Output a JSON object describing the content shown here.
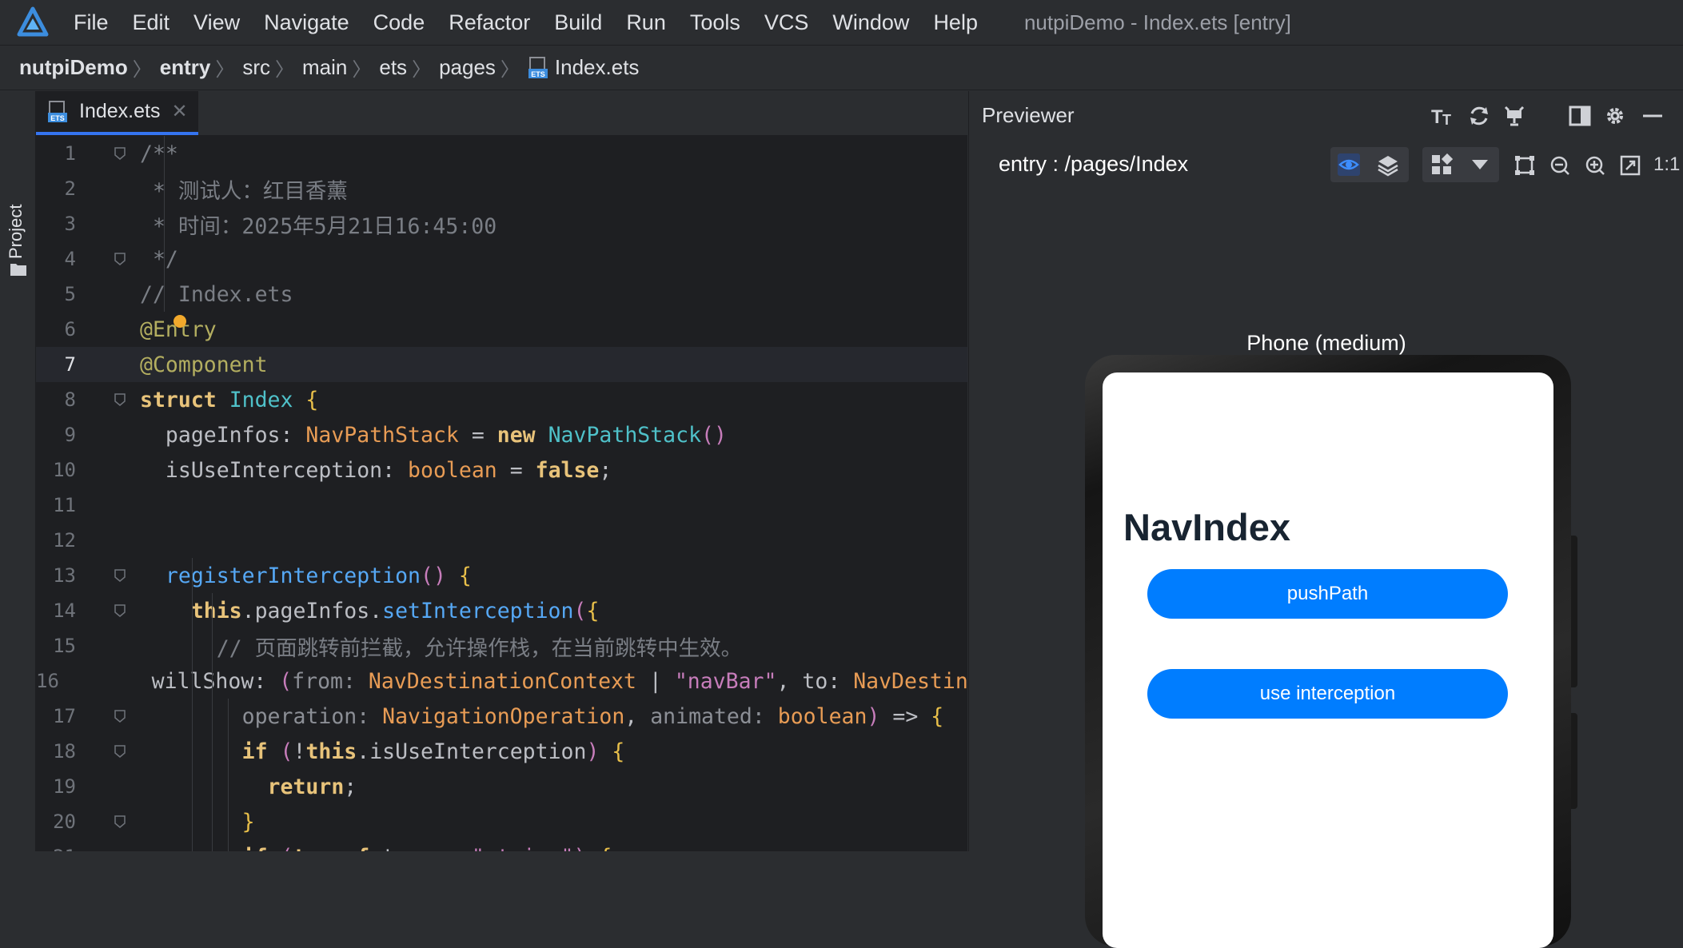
{
  "app": {
    "menu": [
      "File",
      "Edit",
      "View",
      "Navigate",
      "Code",
      "Refactor",
      "Build",
      "Run",
      "Tools",
      "VCS",
      "Window",
      "Help"
    ],
    "window_title": "nutpiDemo - Index.ets [entry]"
  },
  "breadcrumb": [
    {
      "label": "nutpiDemo",
      "bold": true
    },
    {
      "label": "entry",
      "bold": true
    },
    {
      "label": "src",
      "bold": false
    },
    {
      "label": "main",
      "bold": false
    },
    {
      "label": "ets",
      "bold": false
    },
    {
      "label": "pages",
      "bold": false
    },
    {
      "label": "Index.ets",
      "bold": false
    }
  ],
  "tool_strip": {
    "project_label": "Project"
  },
  "editor": {
    "tab_label": "Index.ets",
    "current_line": 7,
    "lines": [
      {
        "n": 1,
        "tokens": [
          [
            "c-com",
            "/**"
          ]
        ]
      },
      {
        "n": 2,
        "tokens": [
          [
            "c-com",
            " * 测试人：红目香薰"
          ]
        ]
      },
      {
        "n": 3,
        "tokens": [
          [
            "c-com",
            " * 时间：2025年5月21日16:45:00"
          ]
        ]
      },
      {
        "n": 4,
        "tokens": [
          [
            "c-com",
            " */"
          ]
        ]
      },
      {
        "n": 5,
        "tokens": [
          [
            "c-com",
            "// Index.ets"
          ]
        ]
      },
      {
        "n": 6,
        "tokens": [
          [
            "c-ann",
            "@Entry"
          ]
        ]
      },
      {
        "n": 7,
        "tokens": [
          [
            "c-ann",
            "@Component"
          ]
        ]
      },
      {
        "n": 8,
        "tokens": [
          [
            "c-kw2",
            "struct "
          ],
          [
            "c-cls",
            "Index "
          ],
          [
            "c-yel",
            "{"
          ]
        ]
      },
      {
        "n": 9,
        "tokens": [
          [
            "c-punc",
            "  pageInfos: "
          ],
          [
            "c-org",
            "NavPathStack "
          ],
          [
            "c-punc",
            "= "
          ],
          [
            "c-kw2",
            "new "
          ],
          [
            "c-cls",
            "NavPathStack"
          ],
          [
            "c-str",
            "()"
          ]
        ]
      },
      {
        "n": 10,
        "tokens": [
          [
            "c-punc",
            "  isUseInterception: "
          ],
          [
            "c-org",
            "boolean "
          ],
          [
            "c-punc",
            "= "
          ],
          [
            "c-bool",
            "false"
          ],
          [
            "c-punc",
            ";"
          ]
        ]
      },
      {
        "n": 11,
        "tokens": [
          [
            "c-punc",
            ""
          ]
        ]
      },
      {
        "n": 12,
        "tokens": [
          [
            "c-punc",
            ""
          ]
        ]
      },
      {
        "n": 13,
        "tokens": [
          [
            "c-fn",
            "  registerInterception"
          ],
          [
            "c-str",
            "() "
          ],
          [
            "c-yel",
            "{"
          ]
        ]
      },
      {
        "n": 14,
        "tokens": [
          [
            "c-kw2",
            "    this"
          ],
          [
            "c-punc",
            ".pageInfos."
          ],
          [
            "c-fn",
            "setInterception"
          ],
          [
            "c-str",
            "("
          ],
          [
            "c-yel",
            "{"
          ]
        ]
      },
      {
        "n": 15,
        "tokens": [
          [
            "c-com",
            "      // 页面跳转前拦截，允许操作栈，在当前跳转中生效。"
          ]
        ]
      },
      {
        "n": 16,
        "tokens": [
          [
            "c-punc",
            "      willShow: "
          ],
          [
            "c-str",
            "("
          ],
          [
            "c-gray",
            "from: "
          ],
          [
            "c-org",
            "NavDestinationContext "
          ],
          [
            "c-punc",
            "| "
          ],
          [
            "c-str",
            "\"navBar\""
          ],
          [
            "c-punc",
            ", to: "
          ],
          [
            "c-org",
            "NavDestinationContext"
          ]
        ]
      },
      {
        "n": 17,
        "tokens": [
          [
            "c-gray",
            "        operation: "
          ],
          [
            "c-org",
            "NavigationOperation"
          ],
          [
            "c-punc",
            ", "
          ],
          [
            "c-gray",
            "animated: "
          ],
          [
            "c-org",
            "boolean"
          ],
          [
            "c-str",
            ") "
          ],
          [
            "c-punc",
            "=> "
          ],
          [
            "c-yel",
            "{"
          ]
        ]
      },
      {
        "n": 18,
        "tokens": [
          [
            "c-kw2",
            "        if "
          ],
          [
            "c-str",
            "("
          ],
          [
            "c-punc",
            "!"
          ],
          [
            "c-kw2",
            "this"
          ],
          [
            "c-punc",
            ".isUseInterception"
          ],
          [
            "c-str",
            ") "
          ],
          [
            "c-yel",
            "{"
          ]
        ]
      },
      {
        "n": 19,
        "tokens": [
          [
            "c-kw2",
            "          return"
          ],
          [
            "c-punc",
            ";"
          ]
        ]
      },
      {
        "n": 20,
        "tokens": [
          [
            "c-yel",
            "        }"
          ]
        ]
      },
      {
        "n": 21,
        "tokens": [
          [
            "c-kw2",
            "        if "
          ],
          [
            "c-str",
            "("
          ],
          [
            "c-kw2",
            "typeof "
          ],
          [
            "c-punc",
            "to === "
          ],
          [
            "c-str",
            "\"string\""
          ],
          [
            "c-str",
            ") "
          ],
          [
            "c-yel",
            "{"
          ]
        ]
      }
    ]
  },
  "previewer": {
    "title": "Previewer",
    "route": "entry : /pages/Index",
    "zoom_label": "1:1",
    "device_name": "Phone (medium)",
    "screen": {
      "title": "NavIndex",
      "buttons": [
        "pushPath",
        "use interception"
      ]
    },
    "accent": "#007dff"
  }
}
